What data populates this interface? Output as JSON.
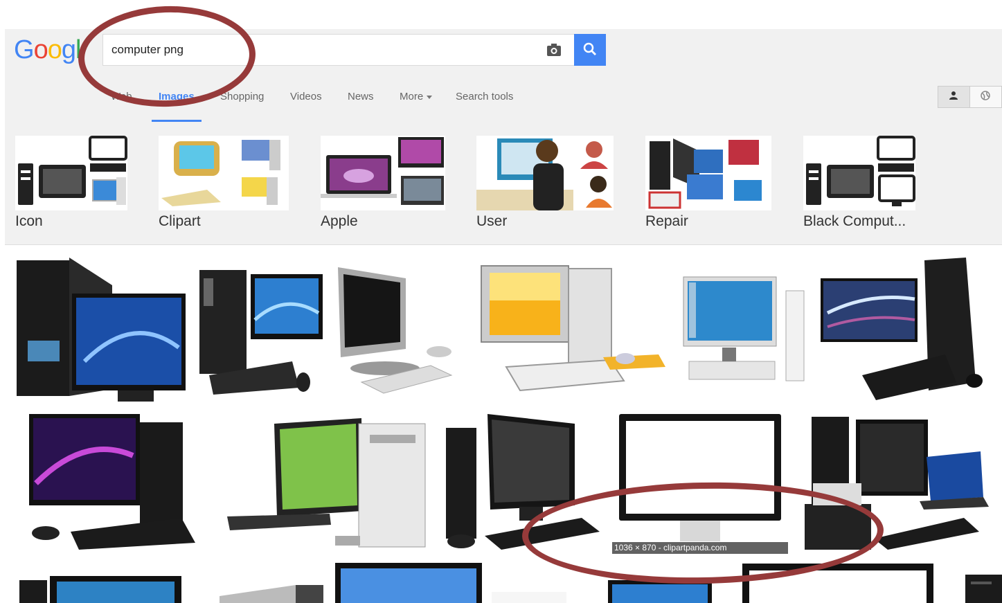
{
  "search": {
    "query": "computer png"
  },
  "nav": {
    "tabs": [
      {
        "label": "Web"
      },
      {
        "label": "Images"
      },
      {
        "label": "Shopping"
      },
      {
        "label": "Videos"
      },
      {
        "label": "News"
      },
      {
        "label": "More"
      },
      {
        "label": "Search tools"
      }
    ],
    "active_tab": "Images"
  },
  "related_searches": [
    {
      "label": "Icon"
    },
    {
      "label": "Clipart"
    },
    {
      "label": "Apple"
    },
    {
      "label": "User"
    },
    {
      "label": "Repair"
    },
    {
      "label": "Black Comput..."
    }
  ],
  "hover_caption": "1036 × 870 - clipartpanda.com",
  "colors": {
    "accent": "#4285f4",
    "annotation": "#963a3a"
  }
}
